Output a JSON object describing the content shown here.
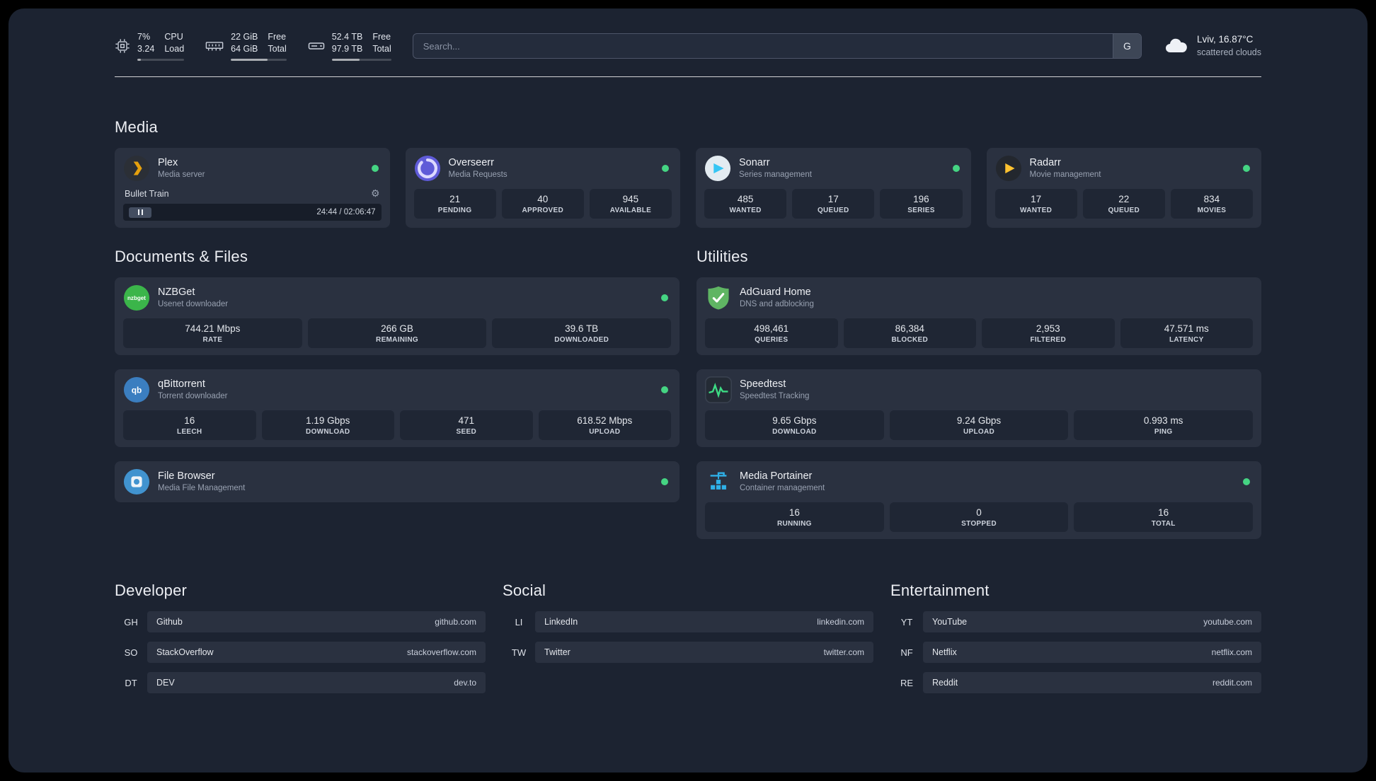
{
  "topbar": {
    "resources": [
      {
        "icon": "cpu-icon",
        "values": [
          "7%",
          "3.24"
        ],
        "labels": [
          "CPU",
          "Load"
        ],
        "progress": "7%"
      },
      {
        "icon": "memory-icon",
        "values": [
          "22 GiB",
          "64 GiB"
        ],
        "labels": [
          "Free",
          "Total"
        ],
        "progress": "66%"
      },
      {
        "icon": "disk-icon",
        "values": [
          "52.4 TB",
          "97.9 TB"
        ],
        "labels": [
          "Free",
          "Total"
        ],
        "progress": "47%"
      }
    ],
    "search": {
      "placeholder": "Search...",
      "provider_label": "G"
    },
    "weather": {
      "location": "Lviv, 16.87°C",
      "condition": "scattered clouds"
    }
  },
  "sections": {
    "media": {
      "title": "Media",
      "cards": [
        {
          "name": "Plex",
          "subtitle": "Media server",
          "status": "online",
          "player": {
            "track": "Bullet Train",
            "time": "24:44 / 02:06:47"
          }
        },
        {
          "name": "Overseerr",
          "subtitle": "Media Requests",
          "status": "online",
          "stats": [
            {
              "value": "21",
              "label": "PENDING"
            },
            {
              "value": "40",
              "label": "APPROVED"
            },
            {
              "value": "945",
              "label": "AVAILABLE"
            }
          ]
        },
        {
          "name": "Sonarr",
          "subtitle": "Series management",
          "status": "online",
          "stats": [
            {
              "value": "485",
              "label": "WANTED"
            },
            {
              "value": "17",
              "label": "QUEUED"
            },
            {
              "value": "196",
              "label": "SERIES"
            }
          ]
        },
        {
          "name": "Radarr",
          "subtitle": "Movie management",
          "status": "online",
          "stats": [
            {
              "value": "17",
              "label": "WANTED"
            },
            {
              "value": "22",
              "label": "QUEUED"
            },
            {
              "value": "834",
              "label": "MOVIES"
            }
          ]
        }
      ]
    },
    "documents": {
      "title": "Documents & Files",
      "cards": [
        {
          "name": "NZBGet",
          "subtitle": "Usenet downloader",
          "status": "online",
          "stats": [
            {
              "value": "744.21 Mbps",
              "label": "RATE"
            },
            {
              "value": "266 GB",
              "label": "REMAINING"
            },
            {
              "value": "39.6 TB",
              "label": "DOWNLOADED"
            }
          ]
        },
        {
          "name": "qBittorrent",
          "subtitle": "Torrent downloader",
          "status": "online",
          "stats": [
            {
              "value": "16",
              "label": "LEECH"
            },
            {
              "value": "1.19 Gbps",
              "label": "DOWNLOAD"
            },
            {
              "value": "471",
              "label": "SEED"
            },
            {
              "value": "618.52 Mbps",
              "label": "UPLOAD"
            }
          ]
        },
        {
          "name": "File Browser",
          "subtitle": "Media File Management",
          "status": "online"
        }
      ]
    },
    "utilities": {
      "title": "Utilities",
      "cards": [
        {
          "name": "AdGuard Home",
          "subtitle": "DNS and adblocking",
          "stats": [
            {
              "value": "498,461",
              "label": "QUERIES"
            },
            {
              "value": "86,384",
              "label": "BLOCKED"
            },
            {
              "value": "2,953",
              "label": "FILTERED"
            },
            {
              "value": "47.571 ms",
              "label": "LATENCY"
            }
          ]
        },
        {
          "name": "Speedtest",
          "subtitle": "Speedtest Tracking",
          "stats": [
            {
              "value": "9.65 Gbps",
              "label": "DOWNLOAD"
            },
            {
              "value": "9.24 Gbps",
              "label": "UPLOAD"
            },
            {
              "value": "0.993 ms",
              "label": "PING"
            }
          ]
        },
        {
          "name": "Media Portainer",
          "subtitle": "Container management",
          "status": "online",
          "stats": [
            {
              "value": "16",
              "label": "RUNNING"
            },
            {
              "value": "0",
              "label": "STOPPED"
            },
            {
              "value": "16",
              "label": "TOTAL"
            }
          ]
        }
      ]
    },
    "bookmarks": {
      "groups": [
        {
          "title": "Developer",
          "items": [
            {
              "abbr": "GH",
              "name": "Github",
              "url": "github.com"
            },
            {
              "abbr": "SO",
              "name": "StackOverflow",
              "url": "stackoverflow.com"
            },
            {
              "abbr": "DT",
              "name": "DEV",
              "url": "dev.to"
            }
          ]
        },
        {
          "title": "Social",
          "items": [
            {
              "abbr": "LI",
              "name": "LinkedIn",
              "url": "linkedin.com"
            },
            {
              "abbr": "TW",
              "name": "Twitter",
              "url": "twitter.com"
            }
          ]
        },
        {
          "title": "Entertainment",
          "items": [
            {
              "abbr": "YT",
              "name": "YouTube",
              "url": "youtube.com"
            },
            {
              "abbr": "NF",
              "name": "Netflix",
              "url": "netflix.com"
            },
            {
              "abbr": "RE",
              "name": "Reddit",
              "url": "reddit.com"
            }
          ]
        }
      ]
    }
  },
  "glyphs": {
    "gear": "⚙",
    "nzbget": "nzbget",
    "qb": "qb"
  },
  "colors": {
    "status_online": "#45d483",
    "accent_plex": "#e5a00d",
    "background": "#1c2331"
  }
}
